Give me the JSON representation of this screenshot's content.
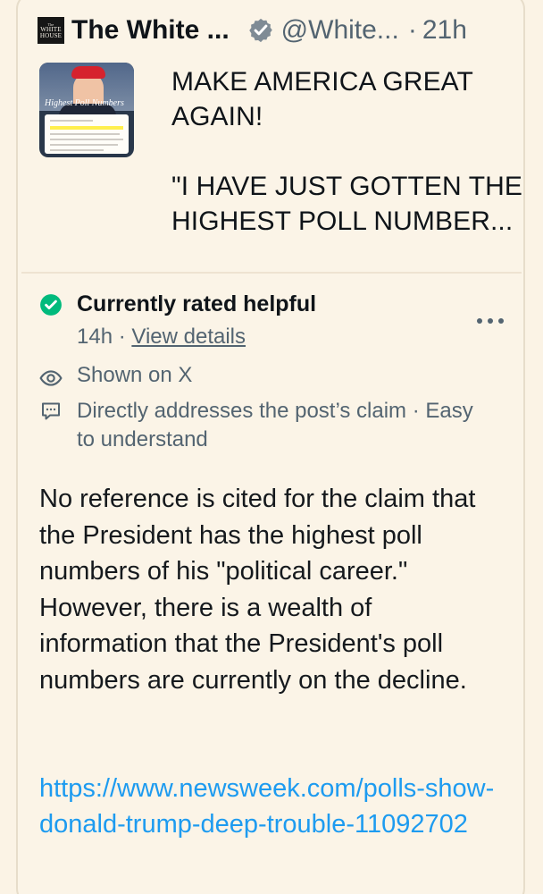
{
  "quoted_post": {
    "avatar_text": [
      "The",
      "WHITE",
      "HOUSE"
    ],
    "account_name": "The White ...",
    "handle": "@White...",
    "separator_dot": "·",
    "time": "21h",
    "text": "MAKE AMERICA GREAT AGAIN!\n\n\"I HAVE JUST GOTTEN THE HIGHEST POLL NUMBER...",
    "image": {
      "title": "Highest Poll Numbers"
    }
  },
  "community_note": {
    "status": "Currently rated helpful",
    "meta": {
      "age": "14h",
      "separator": " · ",
      "details_link": "View details"
    },
    "shown_on": "Shown on X",
    "reasons": "Directly addresses the post’s claim · Easy to understand",
    "body": "No reference is cited for the claim that the President has the highest poll numbers of his \"political career.\" However, there is a wealth of information that the President's poll numbers are currently on the decline.",
    "source_link": "https://www.newsweek.com/polls-show-donald-trump-deep-trouble-11092702"
  },
  "icons": {
    "verified": "verified-badge-icon",
    "helpful": "check-circle-icon",
    "more": "more-icon",
    "shown": "eye-icon",
    "reasons": "message-icon"
  },
  "colors": {
    "background": "#fbf3e5",
    "secondary_text": "#536471",
    "link": "#1d9bf0",
    "helpful_green": "#00ba7c"
  }
}
